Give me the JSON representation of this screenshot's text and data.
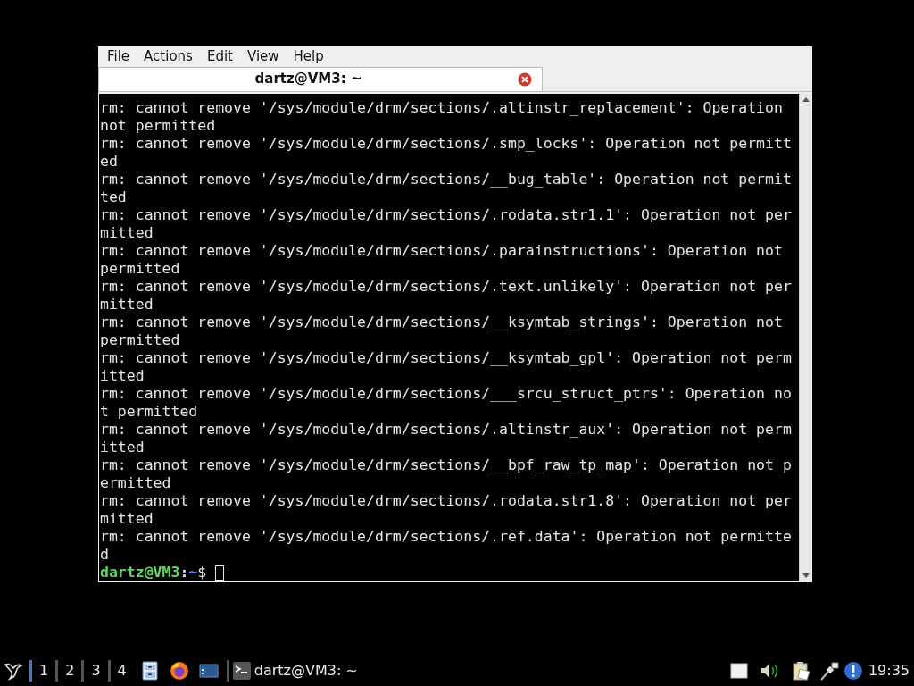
{
  "window": {
    "menu": [
      "File",
      "Actions",
      "Edit",
      "View",
      "Help"
    ],
    "tabs": [
      {
        "title": "dartz@VM3: ~",
        "selected": true
      }
    ]
  },
  "terminal": {
    "lines": [
      "rm: cannot remove '/sys/module/drm/sections/.altinstr_replacement': Operation not permitted",
      "rm: cannot remove '/sys/module/drm/sections/.smp_locks': Operation not permitted",
      "rm: cannot remove '/sys/module/drm/sections/__bug_table': Operation not permitted",
      "rm: cannot remove '/sys/module/drm/sections/.rodata.str1.1': Operation not permitted",
      "rm: cannot remove '/sys/module/drm/sections/.parainstructions': Operation not permitted",
      "rm: cannot remove '/sys/module/drm/sections/.text.unlikely': Operation not permitted",
      "rm: cannot remove '/sys/module/drm/sections/__ksymtab_strings': Operation not permitted",
      "rm: cannot remove '/sys/module/drm/sections/__ksymtab_gpl': Operation not permitted",
      "rm: cannot remove '/sys/module/drm/sections/___srcu_struct_ptrs': Operation not permitted",
      "rm: cannot remove '/sys/module/drm/sections/.altinstr_aux': Operation not permitted",
      "rm: cannot remove '/sys/module/drm/sections/__bpf_raw_tp_map': Operation not permitted",
      "rm: cannot remove '/sys/module/drm/sections/.rodata.str1.8': Operation not permitted",
      "rm: cannot remove '/sys/module/drm/sections/.ref.data': Operation not permitted"
    ],
    "prompt": {
      "user_host": "dartz@VM3",
      "separator": ":",
      "path": "~",
      "symbol": "$"
    }
  },
  "taskbar": {
    "workspaces": [
      {
        "label": "1",
        "selected": true
      },
      {
        "label": "2",
        "selected": false
      },
      {
        "label": "3",
        "selected": false
      },
      {
        "label": "4",
        "selected": false
      }
    ],
    "tasks": [
      {
        "title": "dartz@VM3: ~"
      }
    ],
    "clock": "19:35"
  }
}
